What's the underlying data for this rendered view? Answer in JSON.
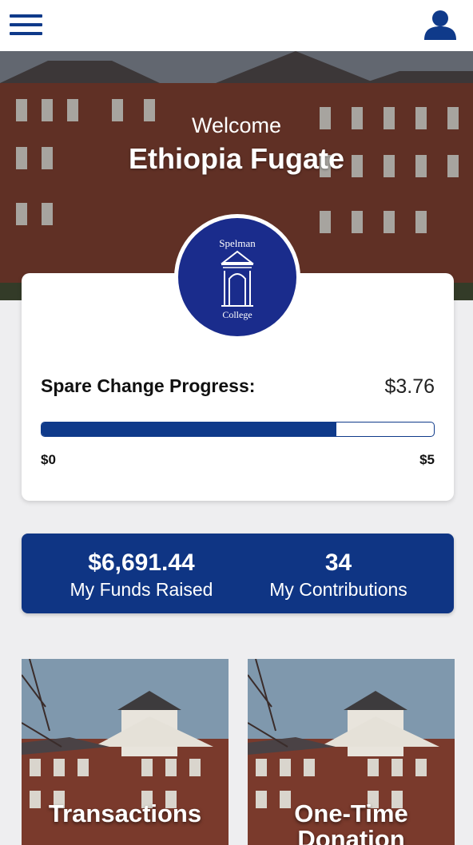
{
  "header": {
    "menu_icon": "hamburger-menu-icon",
    "profile_icon": "user-profile-icon",
    "accent": "#0f3a8a"
  },
  "hero": {
    "welcome": "Welcome",
    "name": "Ethiopia Fugate"
  },
  "logo": {
    "line1": "Spelman",
    "line2": "College"
  },
  "progress": {
    "label": "Spare Change Progress:",
    "value": "$3.76",
    "min_label": "$0",
    "max_label": "$5",
    "fraction": 0.752
  },
  "stats": {
    "funds_value": "$6,691.44",
    "funds_label": "My Funds Raised",
    "contrib_value": "34",
    "contrib_label": "My Contributions",
    "background": "#0f3584"
  },
  "tiles": [
    {
      "label": "Transactions"
    },
    {
      "label": "One-Time Donation"
    }
  ]
}
